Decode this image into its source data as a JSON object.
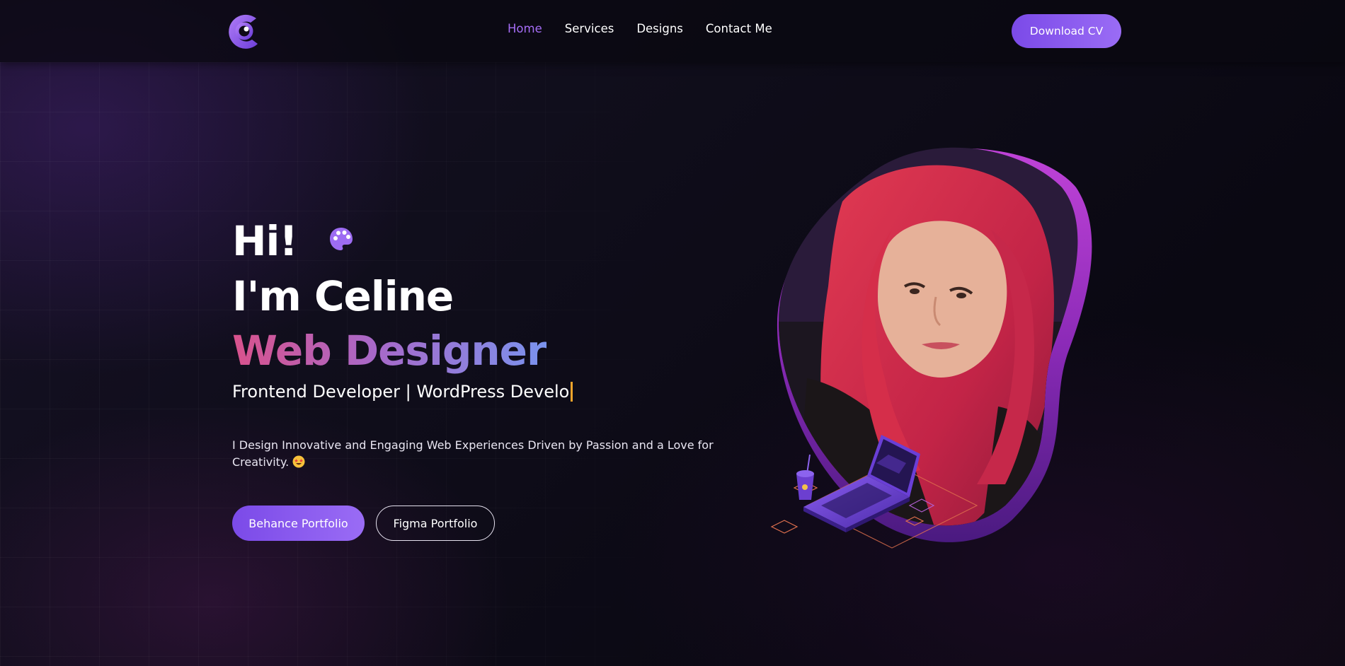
{
  "header": {
    "nav": [
      {
        "label": "Home",
        "active": true
      },
      {
        "label": "Services",
        "active": false
      },
      {
        "label": "Designs",
        "active": false
      },
      {
        "label": "Contact Me",
        "active": false
      }
    ],
    "cta_label": "Download CV"
  },
  "hero": {
    "greeting": "Hi!",
    "name": "I'm Celine",
    "role": "Web Designer",
    "typed_text": "Frontend Developer | WordPress Develo",
    "tagline": "I Design Innovative and Engaging Web Experiences Driven by Passion and a Love for Creativity.",
    "buttons": {
      "behance": "Behance Portfolio",
      "figma": "Figma Portfolio"
    },
    "icons": {
      "greeting_icon": "palette-icon",
      "tagline_emoji": "star-struck-emoji-icon",
      "logo": "c-logo-icon"
    }
  },
  "colors": {
    "accent": "#9a6cf5",
    "nav_active": "#a56df5",
    "role_gradient": [
      "#d9528c",
      "#a868c8",
      "#7a93ee"
    ],
    "caret": "#f3a52b",
    "background": "#0d0b17"
  }
}
